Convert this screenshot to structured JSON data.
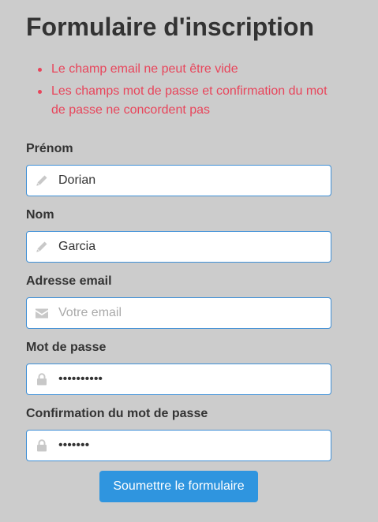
{
  "form": {
    "title": "Formulaire d'inscription",
    "errors": [
      "Le champ email ne peut être vide",
      "Les champs mot de passe et confirmation du mot de passe ne concordent pas"
    ],
    "fields": {
      "firstname": {
        "label": "Prénom",
        "value": "Dorian",
        "placeholder": "",
        "icon": "pencil-icon"
      },
      "lastname": {
        "label": "Nom",
        "value": "Garcia",
        "placeholder": "",
        "icon": "pencil-icon"
      },
      "email": {
        "label": "Adresse email",
        "value": "",
        "placeholder": "Votre email",
        "icon": "envelope-icon"
      },
      "password": {
        "label": "Mot de passe",
        "value": "••••••••••",
        "placeholder": "",
        "icon": "lock-icon"
      },
      "password_confirm": {
        "label": "Confirmation du mot de passe",
        "value": "•••••••",
        "placeholder": "",
        "icon": "lock-icon"
      }
    },
    "submit_label": "Soumettre le formulaire"
  },
  "colors": {
    "background": "#cccccc",
    "error": "#e8455b",
    "input_border": "#3e8fd6",
    "button": "#2f95df",
    "icon": "#c8c8c8"
  }
}
